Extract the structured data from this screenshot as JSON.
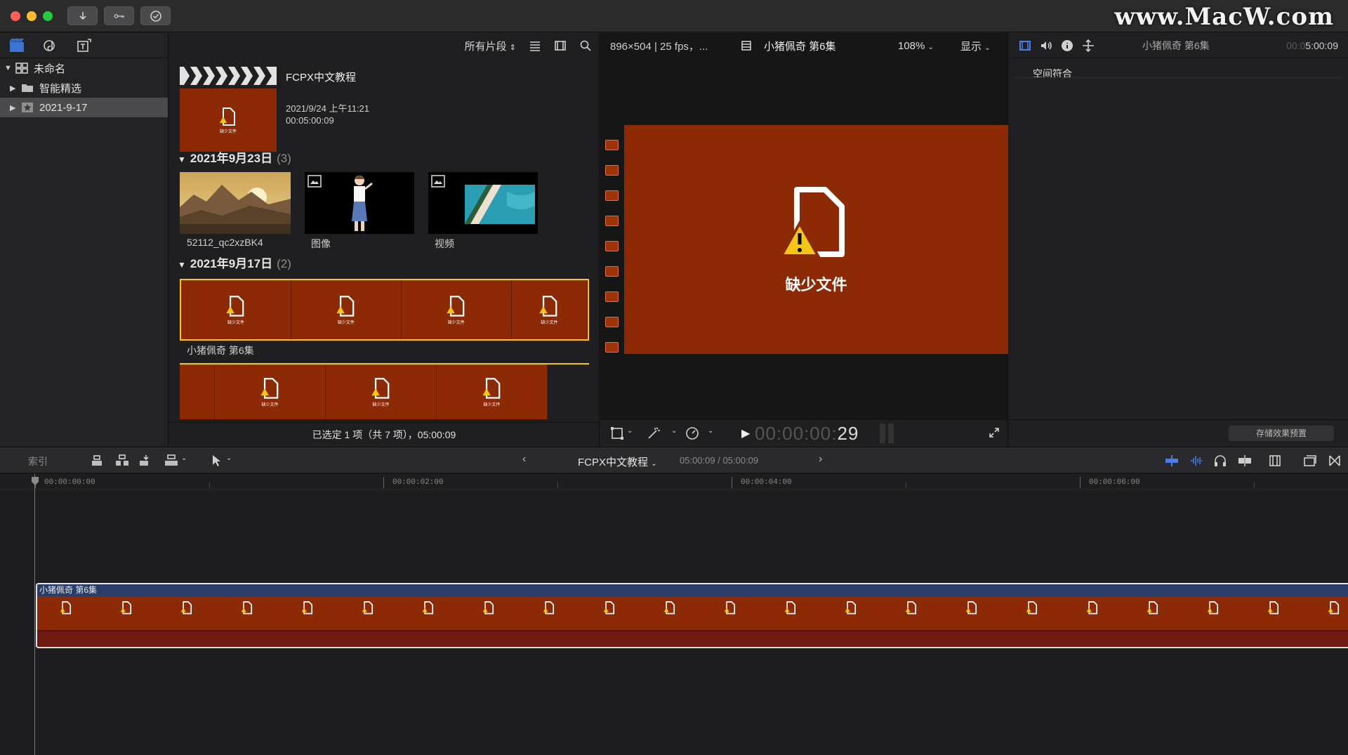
{
  "watermark": "www.MacW.com",
  "colors": {
    "accent": "#f5c518",
    "missing_bg": "#8c2a05",
    "clip_title_bg": "#2a3d66"
  },
  "libraries": {
    "items": [
      {
        "label": "未命名",
        "expanded": true
      },
      {
        "label": "智能精选",
        "expanded": false
      },
      {
        "label": "2021-9-17",
        "expanded": false,
        "selected": true
      }
    ]
  },
  "browser": {
    "filter": "所有片段",
    "event": {
      "title": "FCPX中文教程",
      "date": "2021/9/24 上午11:21",
      "duration": "00:05:00:09"
    },
    "groups": [
      {
        "date": "2021年9月23日",
        "count": "(3)",
        "clips": [
          "52112_qc2xzBK4",
          "图像",
          "视频"
        ]
      },
      {
        "date": "2021年9月17日",
        "count": "(2)",
        "clips": [
          "小猪佩奇 第6集"
        ]
      }
    ],
    "missing_label": "缺少文件",
    "status": "已选定 1 项（共 7 项），05:00:09"
  },
  "viewer": {
    "format": "896×504 | 25 fps，...",
    "clip_name": "小猪佩奇 第6集",
    "zoom": "108%",
    "display": "显示",
    "missing_label": "缺少文件",
    "timecode_dim": "00:00:00:",
    "timecode_bright": "29"
  },
  "inspector": {
    "title": "小猪佩奇 第6集",
    "time_dim": "00:0",
    "time_bright": "5:00:09",
    "row1": "空间符合",
    "save_preset": "存储效果预置"
  },
  "timeline": {
    "index": "索引",
    "project": "FCPX中文教程",
    "position": "05:00:09 / 05:00:09",
    "ruler": [
      "00:00:00:00",
      "00:00:02:00",
      "00:00:04:00",
      "00:00:06:00"
    ],
    "clip_title": "小猪佩奇 第6集"
  }
}
